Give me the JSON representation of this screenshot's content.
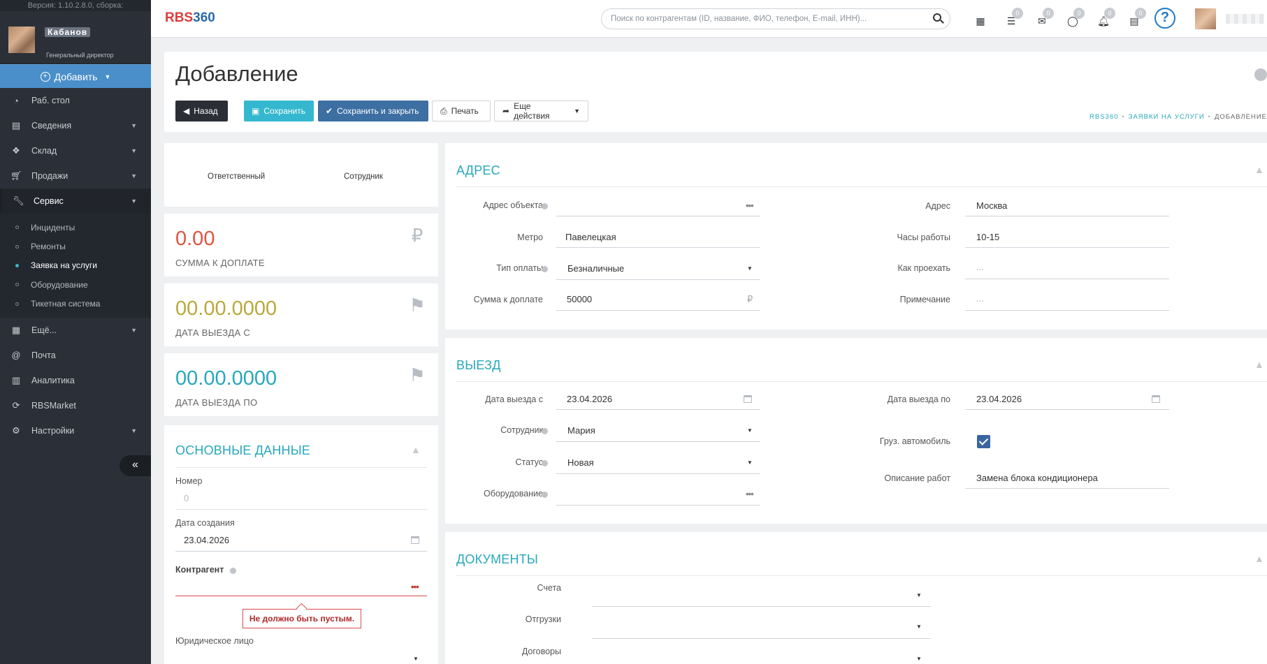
{
  "sidebar": {
    "version": "Версия: 1.10.2.8.0, сборка:",
    "user_name": "Кабанов",
    "user_role": "Генеральный директор",
    "add_label": "Добавить",
    "items": [
      {
        "label": "Раб. стол",
        "icon": "dashboard-icon"
      },
      {
        "label": "Сведения",
        "icon": "id-card-icon"
      },
      {
        "label": "Склад",
        "icon": "cubes-icon"
      },
      {
        "label": "Продажи",
        "icon": "cart-icon"
      },
      {
        "label": "Сервис",
        "icon": "wrench-icon"
      },
      {
        "label": "Ещё...",
        "icon": "grid-icon"
      },
      {
        "label": "Почта",
        "icon": "at-icon"
      },
      {
        "label": "Аналитика",
        "icon": "bar-chart-icon"
      },
      {
        "label": "RBSMarket",
        "icon": "refresh-icon"
      },
      {
        "label": "Настройки",
        "icon": "gear-icon"
      }
    ],
    "sub_items": [
      "Инциденты",
      "Ремонты",
      "Заявка на услуги",
      "Оборудование",
      "Тикетная система"
    ],
    "collapse_label": "«"
  },
  "topbar": {
    "logo_rbs": "RBS",
    "logo_360": "360",
    "search_placeholder": "Поиск по контрагентам (ID, название, ФИО, телефон, E-mail, ИНН)...",
    "badges": [
      "0",
      "0",
      "0",
      "0",
      "0"
    ],
    "help": "?"
  },
  "page": {
    "title": "Добавление",
    "buttons": {
      "back": "Назад",
      "save": "Сохранить",
      "save_close": "Сохранить и закрыть",
      "print": "Печать",
      "more": "Еще действия"
    },
    "breadcrumb": [
      "RBS360",
      "ЗАЯВКИ НА УСЛУГИ",
      "ДОБАВЛЕНИЕ"
    ]
  },
  "left": {
    "responsible_label": "Ответственный",
    "employee_label": "Сотрудник",
    "stats": [
      {
        "value": "0.00",
        "label": "СУММА К ДОПЛАТЕ",
        "color": "#e0533f",
        "icon": "ruble-icon"
      },
      {
        "value": "00.00.0000",
        "label": "ДАТА ВЫЕЗДА С",
        "color": "#b9a93c",
        "icon": "flag-icon"
      },
      {
        "value": "00.00.0000",
        "label": "ДАТА ВЫЕЗДА ПО",
        "color": "#27a8bd",
        "icon": "flag-icon"
      }
    ],
    "main": {
      "title": "ОСНОВНЫЕ ДАННЫЕ",
      "number_label": "Номер",
      "number_value": "0",
      "created_label": "Дата создания",
      "created_value": "23.04.2026",
      "contractor_label": "Контрагент",
      "error": "Не должно быть пустым.",
      "legal_label": "Юридическое лицо"
    }
  },
  "address": {
    "title": "АДРЕС",
    "object_label": "Адрес объекта",
    "object_value": "",
    "metro_label": "Метро",
    "metro_value": "Павелецкая",
    "pay_type_label": "Тип оплаты",
    "pay_type_value": "Безналичные",
    "sum_label": "Сумма к доплате",
    "sum_value": "50000",
    "currency": "₽",
    "addr_label": "Адрес",
    "addr_value": "Москва",
    "hours_label": "Часы работы",
    "hours_value": "10-15",
    "route_label": "Как проехать",
    "route_value": "...",
    "note_label": "Примечание",
    "note_value": "..."
  },
  "exit": {
    "title": "ВЫЕЗД",
    "from_label": "Дата выезда с",
    "from_value": "23.04.2026",
    "employee_label": "Сотрудник",
    "employee_value": "Мария",
    "status_label": "Статус",
    "status_value": "Новая",
    "equipment_label": "Оборудование",
    "to_label": "Дата выезда по",
    "to_value": "23.04.2026",
    "truck_label": "Груз. автомобиль",
    "truck_checked": true,
    "work_label": "Описание работ",
    "work_value": "Замена блока кондиционера"
  },
  "docs": {
    "title": "ДОКУМЕНТЫ",
    "invoices_label": "Счета",
    "shipments_label": "Отгрузки",
    "contracts_label": "Договоры"
  }
}
